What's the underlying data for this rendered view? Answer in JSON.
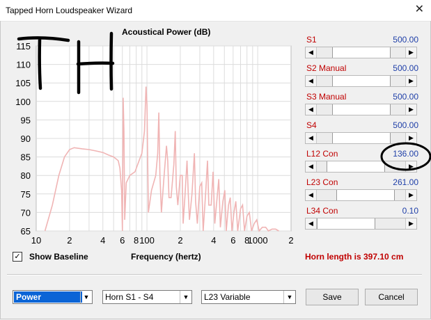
{
  "window": {
    "title": "Tapped Horn Loudspeaker Wizard",
    "close_glyph": "✕"
  },
  "chart_data": {
    "type": "line",
    "title": "Acoustical Power (dB)",
    "xlabel": "Frequency (hertz)",
    "ylabel": "",
    "x_scale": "log",
    "xlim": [
      10,
      2000
    ],
    "ylim": [
      65,
      115
    ],
    "y_ticks": [
      65,
      70,
      75,
      80,
      85,
      90,
      95,
      100,
      105,
      110,
      115
    ],
    "x_ticks": [
      {
        "v": 10,
        "label": "10"
      },
      {
        "v": 20,
        "label": "2"
      },
      {
        "v": 40,
        "label": "4"
      },
      {
        "v": 60,
        "label": "6"
      },
      {
        "v": 80,
        "label": "8"
      },
      {
        "v": 100,
        "label": "100"
      },
      {
        "v": 200,
        "label": "2"
      },
      {
        "v": 400,
        "label": "4"
      },
      {
        "v": 600,
        "label": "6"
      },
      {
        "v": 800,
        "label": "8"
      },
      {
        "v": 1000,
        "label": "1000"
      },
      {
        "v": 2000,
        "label": "2"
      }
    ],
    "grid": true,
    "line_color": "#f0b4b4",
    "series": [
      {
        "points": [
          [
            12,
            65
          ],
          [
            14,
            72
          ],
          [
            16,
            80
          ],
          [
            18,
            85
          ],
          [
            20,
            87
          ],
          [
            22,
            87.5
          ],
          [
            26,
            87.2
          ],
          [
            30,
            87
          ],
          [
            35,
            86.6
          ],
          [
            40,
            86.2
          ],
          [
            45,
            85.5
          ],
          [
            50,
            85
          ],
          [
            55,
            84
          ],
          [
            57,
            82
          ],
          [
            59,
            76
          ],
          [
            60,
            65
          ],
          [
            61,
            101
          ],
          [
            62,
            92
          ],
          [
            63,
            68
          ],
          [
            65,
            78
          ],
          [
            70,
            80
          ],
          [
            78,
            81
          ],
          [
            85,
            84
          ],
          [
            90,
            86
          ],
          [
            95,
            92
          ],
          [
            98,
            104
          ],
          [
            100,
            99
          ],
          [
            103,
            70
          ],
          [
            110,
            76
          ],
          [
            120,
            80
          ],
          [
            125,
            86
          ],
          [
            128,
            97
          ],
          [
            131,
            80
          ],
          [
            135,
            70
          ],
          [
            142,
            79
          ],
          [
            150,
            88
          ],
          [
            154,
            84
          ],
          [
            158,
            74
          ],
          [
            165,
            74
          ],
          [
            175,
            83
          ],
          [
            180,
            92
          ],
          [
            184,
            77
          ],
          [
            190,
            72
          ],
          [
            200,
            80
          ],
          [
            208,
            80
          ],
          [
            212,
            67
          ],
          [
            220,
            74
          ],
          [
            230,
            84
          ],
          [
            236,
            75
          ],
          [
            242,
            68
          ],
          [
            255,
            75
          ],
          [
            268,
            86
          ],
          [
            275,
            73
          ],
          [
            285,
            67
          ],
          [
            300,
            77
          ],
          [
            312,
            78
          ],
          [
            322,
            65
          ],
          [
            340,
            76
          ],
          [
            352,
            84
          ],
          [
            362,
            72
          ],
          [
            380,
            72
          ],
          [
            395,
            81
          ],
          [
            410,
            67
          ],
          [
            430,
            74
          ],
          [
            445,
            79
          ],
          [
            460,
            66
          ],
          [
            485,
            73
          ],
          [
            505,
            76
          ],
          [
            520,
            65
          ],
          [
            545,
            72
          ],
          [
            565,
            74
          ],
          [
            585,
            65
          ],
          [
            610,
            70
          ],
          [
            635,
            73
          ],
          [
            660,
            65
          ],
          [
            700,
            71
          ],
          [
            730,
            72
          ],
          [
            760,
            65
          ],
          [
            800,
            69
          ],
          [
            840,
            70
          ],
          [
            880,
            65
          ],
          [
            930,
            67
          ],
          [
            980,
            68
          ],
          [
            1030,
            65
          ],
          [
            1100,
            66
          ],
          [
            1180,
            66
          ],
          [
            1250,
            65
          ],
          [
            1350,
            65.5
          ],
          [
            1450,
            65.5
          ],
          [
            1550,
            65
          ]
        ]
      }
    ]
  },
  "annotations": {
    "handwriting": "TH"
  },
  "sliders": [
    {
      "label": "S1",
      "value": "500.00",
      "position": 0.52
    },
    {
      "label": "S2  Manual",
      "value": "500.00",
      "position": 0.52
    },
    {
      "label": "S3  Manual",
      "value": "500.00",
      "position": 0.52
    },
    {
      "label": "S4",
      "value": "500.00",
      "position": 0.52
    },
    {
      "label": "L12  Con",
      "value": "136.00",
      "position": 0.33
    },
    {
      "label": "L23  Con",
      "value": "261.00",
      "position": 0.66
    },
    {
      "label": "L34  Con",
      "value": "0.10",
      "position": 0.0
    }
  ],
  "show_baseline": {
    "label": "Show Baseline",
    "checked_glyph": "✓"
  },
  "horn_length": "Horn length is 397.10 cm",
  "combos": {
    "mode": "Power",
    "horn": "Horn S1 - S4",
    "variable": "L23 Variable",
    "arrow_glyph": "▼"
  },
  "buttons": {
    "save": "Save",
    "cancel": "Cancel"
  },
  "glyphs": {
    "left": "◀",
    "right": "▶"
  }
}
